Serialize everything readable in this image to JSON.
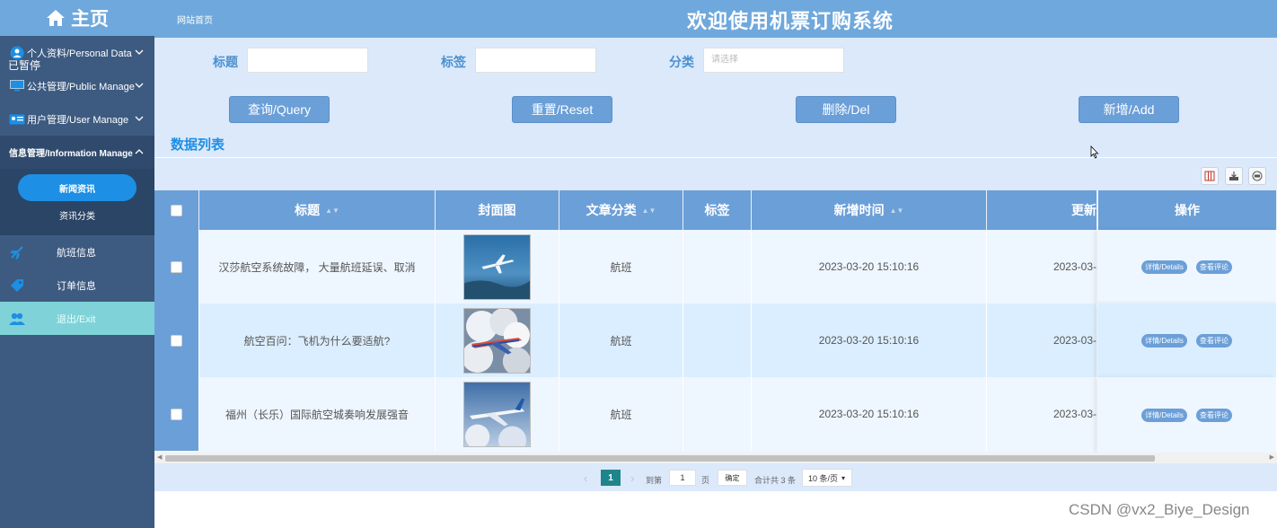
{
  "sidebar": {
    "brand": "主页",
    "paused_label": "已暂停",
    "menu": [
      {
        "label": "个人资料/Personal Data",
        "icon": "user-circle-icon"
      },
      {
        "label": "公共管理/Public Manage",
        "icon": "monitor-icon"
      },
      {
        "label": "用户管理/User Manage",
        "icon": "id-card-icon"
      },
      {
        "label": "信息管理/Information Manage",
        "icon": "none"
      }
    ],
    "submenu": [
      {
        "label": "新闻资讯",
        "active": true
      },
      {
        "label": "资讯分类",
        "active": false
      }
    ],
    "items": [
      {
        "label": "航班信息",
        "icon": "plane-icon"
      },
      {
        "label": "订单信息",
        "icon": "tag-icon"
      },
      {
        "label": "退出/Exit",
        "icon": "users-icon"
      }
    ]
  },
  "header": {
    "breadcrumb": "网站首页",
    "title": "欢迎使用机票订购系统"
  },
  "filters": {
    "title_label": "标题",
    "tag_label": "标签",
    "category_label": "分类",
    "category_placeholder": "请选择"
  },
  "buttons": {
    "query": "查询/Query",
    "reset": "重置/Reset",
    "delete": "删除/Del",
    "add": "新增/Add"
  },
  "list_title": "数据列表",
  "table": {
    "headers": {
      "title": "标题",
      "cover": "封面图",
      "category": "文章分类",
      "tag": "标签",
      "created": "新增时间",
      "updated": "更新",
      "ops": "操作"
    },
    "rows": [
      {
        "title": "汉莎航空系统故障， 大量航班延误、取消",
        "category": "航班",
        "tag": "",
        "created": "2023-03-20 15:10:16",
        "updated": "2023-03-",
        "details": "详情/Details",
        "comments": "查看评论"
      },
      {
        "title": "航空百问：飞机为什么要适航?",
        "category": "航班",
        "tag": "",
        "created": "2023-03-20 15:10:16",
        "updated": "2023-03-",
        "details": "详情/Details",
        "comments": "查看评论"
      },
      {
        "title": "福州（长乐）国际航空城奏响发展强音",
        "category": "航班",
        "tag": "",
        "created": "2023-03-20 15:10:16",
        "updated": "2023-03-",
        "details": "详情/Details",
        "comments": "查看评论"
      }
    ]
  },
  "pagination": {
    "current": "1",
    "goto_label": "到第",
    "page_input": "1",
    "page_unit": "页",
    "confirm": "确定",
    "total": "合计共 3 条",
    "page_size": "10 条/页"
  },
  "watermark": "CSDN @vx2_Biye_Design",
  "colors": {
    "sidebar_bg": "#3d5a80",
    "header_bg": "#6fa8dc",
    "main_bg": "#dbe9fb",
    "button_bg": "#6b9fd8",
    "active_sub": "#1d8fe4",
    "exit_bg": "#7fd3d8",
    "page_active": "#20858a"
  }
}
